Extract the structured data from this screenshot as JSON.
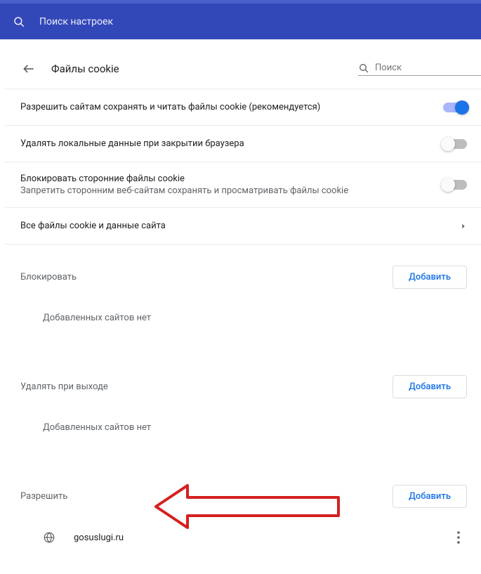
{
  "topbar": {
    "search_placeholder": "Поиск настроек"
  },
  "header": {
    "title": "Файлы cookie",
    "search_placeholder": "Поиск"
  },
  "settings": [
    {
      "title": "Разрешить сайтам сохранять и читать файлы cookie (рекомендуется)",
      "sub": "",
      "toggle": "on"
    },
    {
      "title": "Удалять локальные данные при закрытии браузера",
      "sub": "",
      "toggle": "off"
    },
    {
      "title": "Блокировать сторонние файлы cookie",
      "sub": "Запретить сторонним веб-сайтам сохранять и просматривать файлы cookie",
      "toggle": "off"
    },
    {
      "title": "Все файлы cookie и данные сайта",
      "sub": "",
      "link": true
    }
  ],
  "sections": {
    "block": {
      "title": "Блокировать",
      "add_label": "Добавить",
      "empty_text": "Добавленных сайтов нет"
    },
    "clear_on_exit": {
      "title": "Удалять при выходе",
      "add_label": "Добавить",
      "empty_text": "Добавленных сайтов нет"
    },
    "allow": {
      "title": "Разрешить",
      "add_label": "Добавить",
      "sites": [
        {
          "name": "gosuslugi.ru"
        }
      ]
    }
  }
}
